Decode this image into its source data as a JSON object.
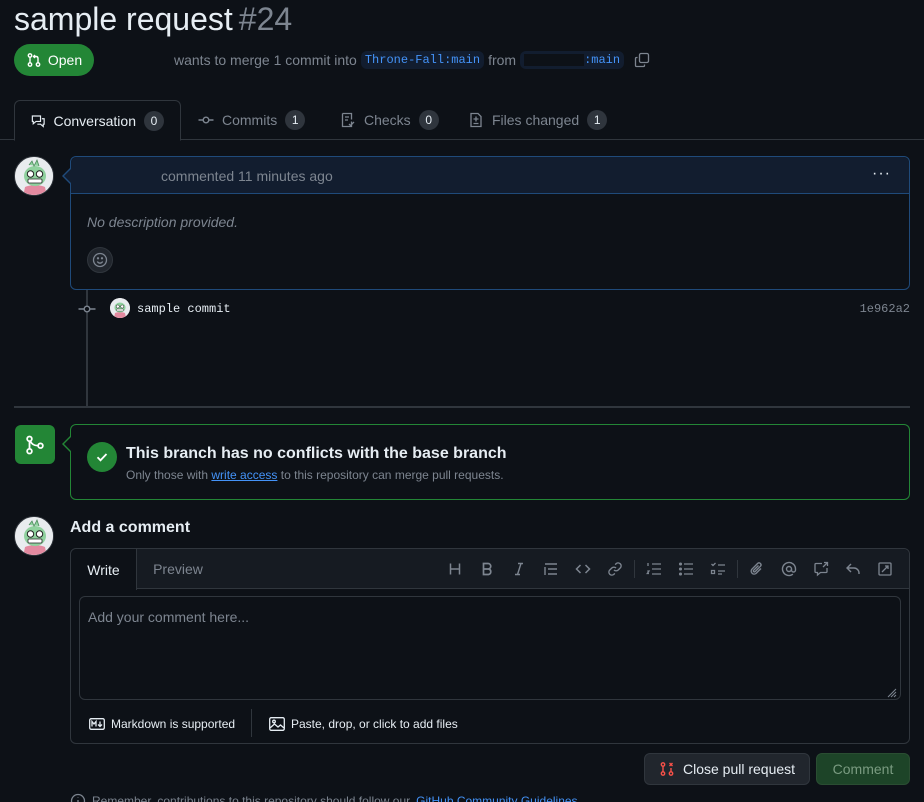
{
  "pr": {
    "title": "sample request",
    "number": "#24",
    "state": "Open",
    "merge_text": "wants to merge 1 commit into",
    "base_branch": "Throne-Fall:main",
    "from_text": "from",
    "head_branch": ":main"
  },
  "tabs": [
    {
      "label": "Conversation",
      "count": "0"
    },
    {
      "label": "Commits",
      "count": "1"
    },
    {
      "label": "Checks",
      "count": "0"
    },
    {
      "label": "Files changed",
      "count": "1"
    }
  ],
  "comment": {
    "meta": "commented 11 minutes ago",
    "body": "No description provided.",
    "more": "···"
  },
  "commit": {
    "message": "sample commit",
    "sha": "1e962a2"
  },
  "merge": {
    "title": "This branch has no conflicts with the base branch",
    "sub_prefix": "Only those with",
    "sub_link": "write access",
    "sub_suffix": "to this repository can merge pull requests."
  },
  "add_comment": {
    "title": "Add a comment",
    "write_tab": "Write",
    "preview_tab": "Preview",
    "placeholder": "Add your comment here...",
    "markdown_note": "Markdown is supported",
    "attach_note": "Paste, drop, or click to add files"
  },
  "actions": {
    "close_label": "Close pull request",
    "comment_label": "Comment"
  },
  "footer": {
    "remember_text": "Remember, contributions to this repository should follow our",
    "guidelines_link": "GitHub Community Guidelines"
  },
  "colors": {
    "background": "#0d1117",
    "accent_green": "#238636",
    "link_blue": "#4493f8",
    "muted": "#7d8590",
    "border": "#30363d"
  }
}
